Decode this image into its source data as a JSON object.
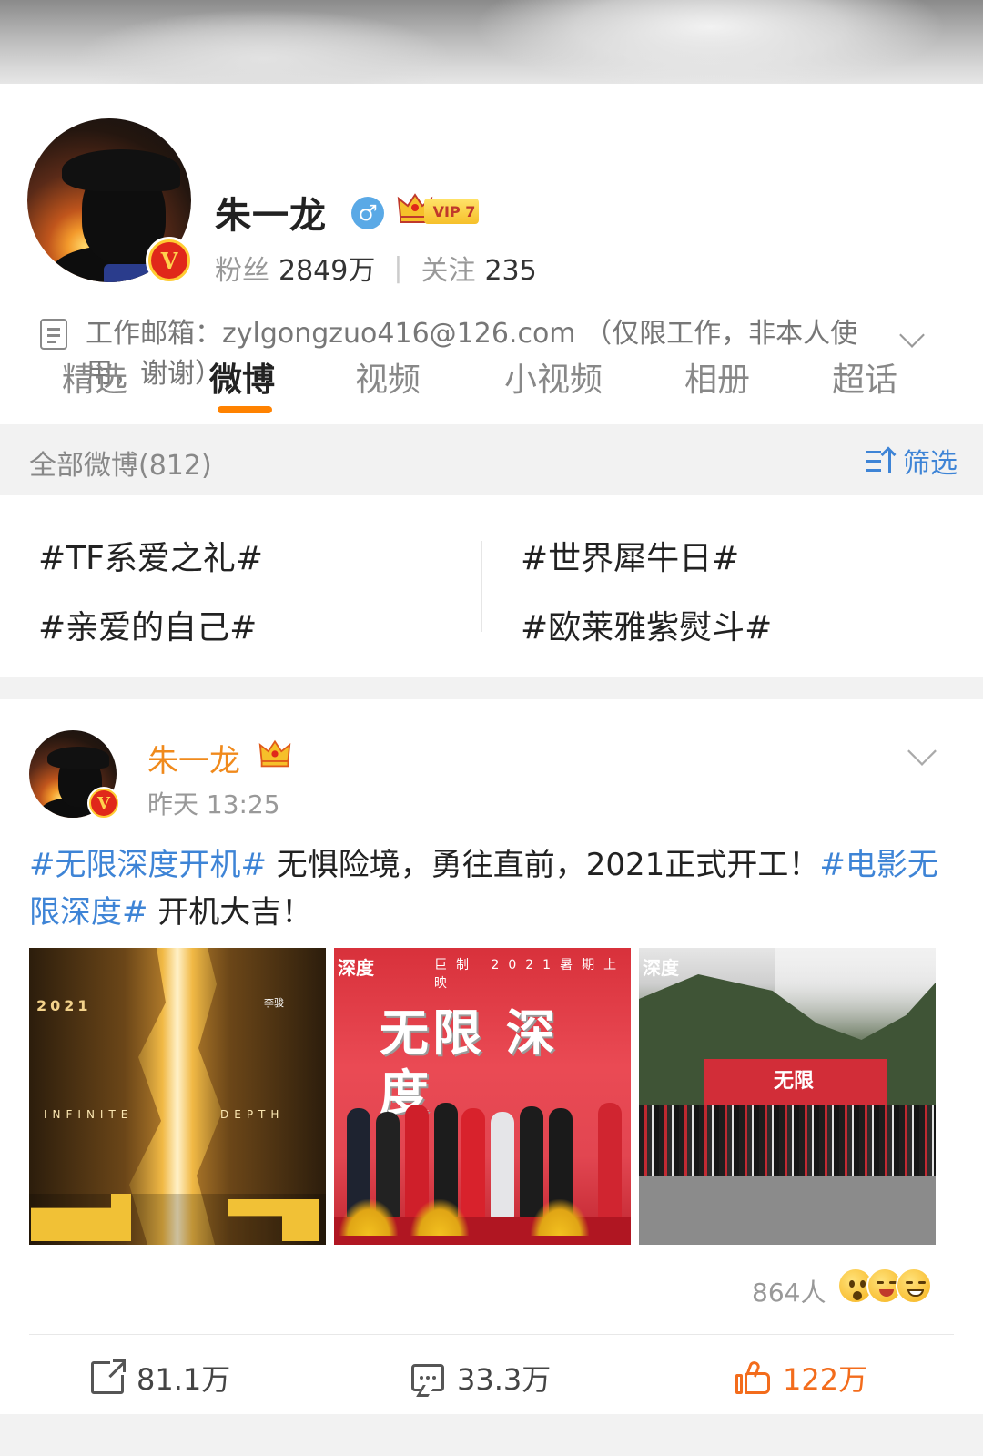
{
  "profile": {
    "name": "朱一龙",
    "vip_label": "VIP 7",
    "followers_label": "粉丝",
    "followers_value": "2849万",
    "following_label": "关注",
    "following_value": "235",
    "intro": "工作邮箱：zylgongzuo416@126.com （仅限工作，非本人使用，谢谢）"
  },
  "tabs": [
    {
      "label": "精选",
      "active": false
    },
    {
      "label": "微博",
      "active": true
    },
    {
      "label": "视频",
      "active": false
    },
    {
      "label": "小视频",
      "active": false
    },
    {
      "label": "相册",
      "active": false
    },
    {
      "label": "超话",
      "active": false
    }
  ],
  "filter_bar": {
    "all_label": "全部微博(812)",
    "filter_label": "筛选"
  },
  "topics": [
    "#TF系爱之礼#",
    "#世界犀牛日#",
    "#亲爱的自己#",
    "#欧莱雅紫熨斗#"
  ],
  "post": {
    "author": "朱一龙",
    "time": "昨天 13:25",
    "text_parts": [
      {
        "text": "#无限深度开机#",
        "hashtag": true
      },
      {
        "text": " 无惧险境，勇往直前，2021正式开工！",
        "hashtag": false
      },
      {
        "text": "#电影无限深度#",
        "hashtag": true
      },
      {
        "text": " 开机大吉！",
        "hashtag": false
      }
    ],
    "photos": {
      "photo1": {
        "year": "2021",
        "infinite": "INFINITE",
        "depth": "DEPTH",
        "name": "李骏"
      },
      "photo2": {
        "top_text": "深度",
        "top_sub": "巨制 2021暑期上映",
        "banner": "无限 深度"
      },
      "photo3": {
        "logo": "深度",
        "stage_text": "无限"
      }
    },
    "reactions": "864人",
    "reposts": "81.1万",
    "comments": "33.3万",
    "likes": "122万"
  },
  "colors": {
    "accent": "#ff8200",
    "link": "#3e84d6",
    "author": "#f08a1c",
    "like": "#f36c1c",
    "verified": "#e0281a"
  }
}
